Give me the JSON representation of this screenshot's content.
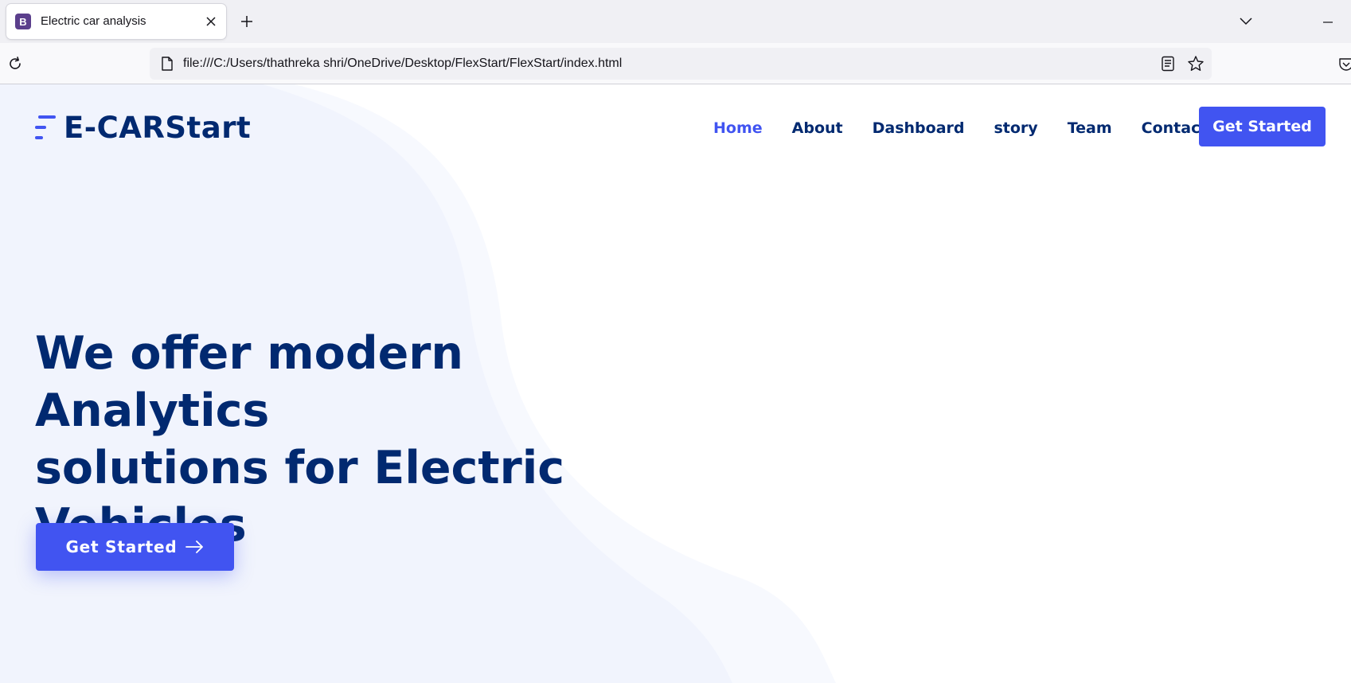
{
  "browser": {
    "tab": {
      "favicon_letter": "B",
      "title": "Electric car analysis"
    },
    "url": "file:///C:/Users/thathreka shri/OneDrive/Desktop/FlexStart/FlexStart/index.html"
  },
  "page": {
    "logo": "E-CARStart",
    "nav": [
      {
        "label": "Home",
        "active": true
      },
      {
        "label": "About"
      },
      {
        "label": "Dashboard"
      },
      {
        "label": "story"
      },
      {
        "label": "Team"
      },
      {
        "label": "Contact"
      }
    ],
    "nav_cta": "Get Started",
    "hero": {
      "title_lines": [
        "We offer modern Analytics",
        "solutions for Electric",
        "Vehicles"
      ],
      "cta": "Get Started"
    }
  },
  "colors": {
    "brand_dark": "#012970",
    "accent": "#4154f1",
    "hero_bg": "#f1f4fd"
  }
}
